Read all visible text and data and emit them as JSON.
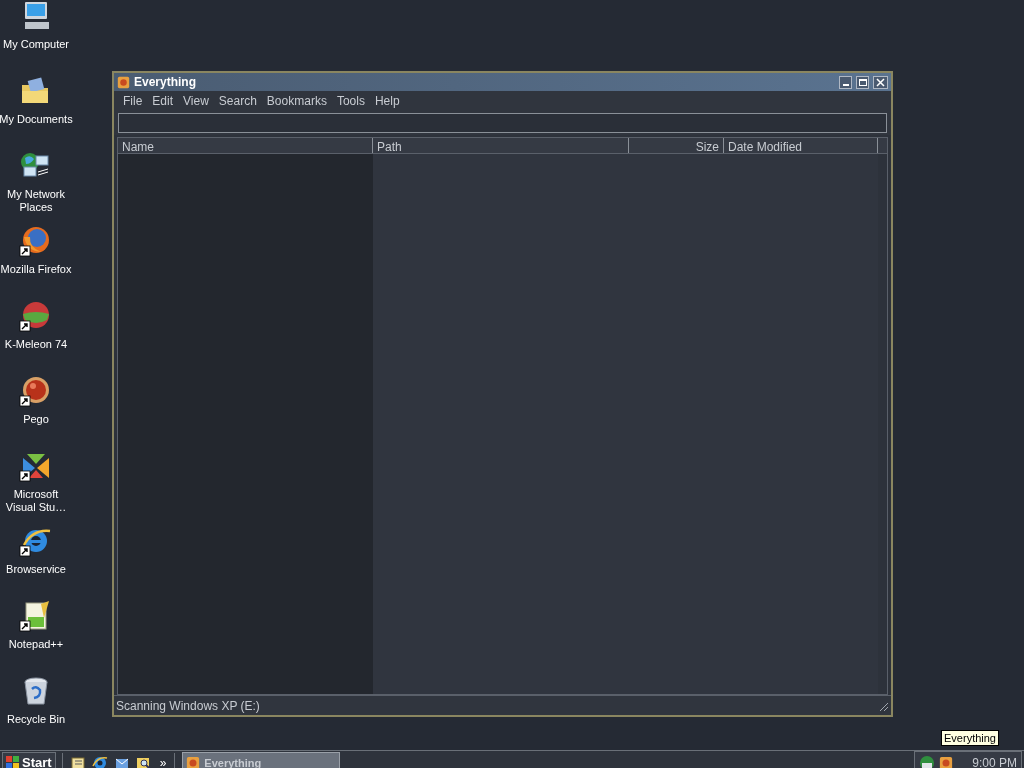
{
  "desktop_icons": [
    {
      "label": "My Computer",
      "kind": "computer",
      "shortcut": false
    },
    {
      "label": "My Documents",
      "kind": "documents",
      "shortcut": false
    },
    {
      "label": "My Network Places",
      "kind": "network",
      "shortcut": false
    },
    {
      "label": "Mozilla Firefox",
      "kind": "firefox",
      "shortcut": true
    },
    {
      "label": "K-Meleon 74",
      "kind": "kmeleon",
      "shortcut": true
    },
    {
      "label": "Pego",
      "kind": "pego",
      "shortcut": true
    },
    {
      "label": "Microsoft Visual Stu…",
      "kind": "studio",
      "shortcut": true
    },
    {
      "label": "Browservice",
      "kind": "ie",
      "shortcut": true
    },
    {
      "label": "Notepad++",
      "kind": "notepad",
      "shortcut": true
    },
    {
      "label": "Recycle Bin",
      "kind": "recycle",
      "shortcut": false
    }
  ],
  "window": {
    "title": "Everything",
    "menu": [
      "File",
      "Edit",
      "View",
      "Search",
      "Bookmarks",
      "Tools",
      "Help"
    ],
    "columns": [
      {
        "label": "Name",
        "sorted": true
      },
      {
        "label": "Path",
        "sorted": false
      },
      {
        "label": "Size",
        "sorted": false
      },
      {
        "label": "Date Modified",
        "sorted": false
      }
    ],
    "status_bar": "Scanning Windows XP (E:)"
  },
  "taskbar": {
    "start": "Start",
    "overflow": "»",
    "tasks": [
      {
        "label": "Everything",
        "selected": false
      }
    ],
    "clock": "9:00 PM",
    "tooltip": "Everything"
  }
}
